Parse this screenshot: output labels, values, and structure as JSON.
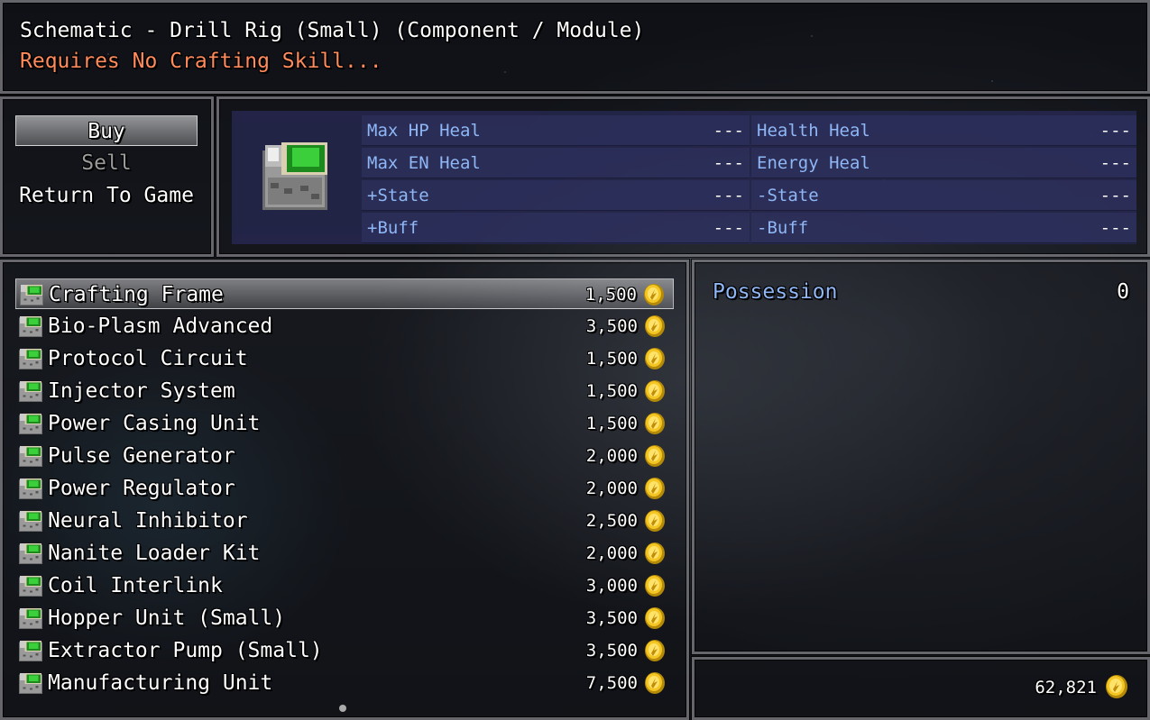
{
  "colors": {
    "system_blue": "#8fb6f5",
    "warning_orange": "#ff8a5c",
    "panel_navy": "#282a55",
    "gold": "#f0c020"
  },
  "help": {
    "line1": "Schematic - Drill Rig (Small) (Component / Module)",
    "line2": "Requires No Crafting Skill..."
  },
  "commands": [
    {
      "label": "Buy",
      "state": "selected"
    },
    {
      "label": "Sell",
      "state": "disabled"
    },
    {
      "label": "Return To Game",
      "state": "normal"
    }
  ],
  "status": {
    "icon": "green-circuit-chip-icon",
    "params": [
      {
        "name": "Max HP Heal",
        "value": "---"
      },
      {
        "name": "Health Heal",
        "value": "---"
      },
      {
        "name": "Max EN Heal",
        "value": "---"
      },
      {
        "name": "Energy Heal",
        "value": "---"
      },
      {
        "name": "+State",
        "value": "---"
      },
      {
        "name": "-State",
        "value": "---"
      },
      {
        "name": "+Buff",
        "value": "---"
      },
      {
        "name": "-Buff",
        "value": "---"
      }
    ]
  },
  "shop_items": [
    {
      "name": "Crafting Frame",
      "price": "1,500"
    },
    {
      "name": "Bio-Plasm Advanced",
      "price": "3,500"
    },
    {
      "name": "Protocol Circuit",
      "price": "1,500"
    },
    {
      "name": "Injector System",
      "price": "1,500"
    },
    {
      "name": "Power Casing Unit",
      "price": "1,500"
    },
    {
      "name": "Pulse Generator",
      "price": "2,000"
    },
    {
      "name": "Power Regulator",
      "price": "2,000"
    },
    {
      "name": "Neural Inhibitor",
      "price": "2,500"
    },
    {
      "name": "Nanite Loader Kit",
      "price": "2,000"
    },
    {
      "name": "Coil Interlink",
      "price": "3,000"
    },
    {
      "name": "Hopper Unit (Small)",
      "price": "3,500"
    },
    {
      "name": "Extractor Pump (Small)",
      "price": "3,500"
    },
    {
      "name": "Manufacturing Unit",
      "price": "7,500"
    }
  ],
  "selected_index": 0,
  "possession": {
    "label": "Possession",
    "value": "0"
  },
  "gold": {
    "amount": "62,821",
    "icon": "gold-coin-icon"
  }
}
